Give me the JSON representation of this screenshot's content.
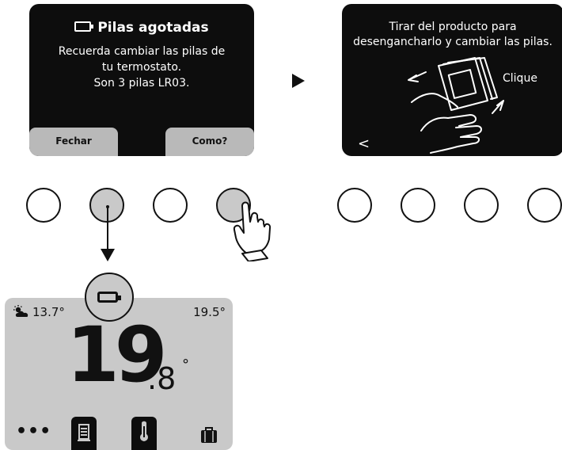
{
  "screen1": {
    "title": "Pilas agotadas",
    "message": "Recuerda cambiar las pilas de\ntu termostato.\nSon 3 pilas LR03.",
    "left_button": "Fechar",
    "right_button": "Como?"
  },
  "screen2": {
    "instruction": "Tirar del producto para\ndesengancharlo y cambiar las pilas.",
    "click_label": "Clique",
    "back_glyph": "<"
  },
  "thermostat": {
    "outdoor_temp": "13.7°",
    "setpoint": "19.5°",
    "temp_integer": "19",
    "temp_decimal": ".8",
    "degree_symbol": "°",
    "menu_dots": "•••"
  },
  "icons": [
    "battery-icon",
    "weather-sun-cloud-icon",
    "schedule-icon",
    "thermometer-icon",
    "travel-suitcase-icon",
    "hand-pointer-icon",
    "hand-pulling-device-icon",
    "arrow-down-icon",
    "play-arrow-icon"
  ],
  "colors": {
    "screen_bg": "#0d0d0d",
    "button_grey": "#b9b9b9",
    "thermostat_bg": "#c9c9c9"
  }
}
